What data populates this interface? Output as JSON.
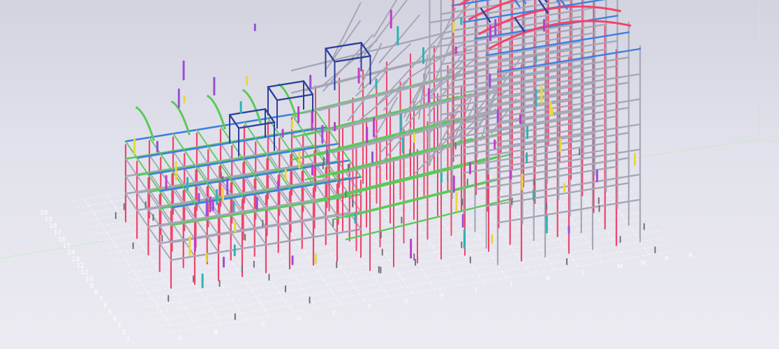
{
  "view": {
    "background_top": "#d3d3e0",
    "background_bottom": "#ecebf2"
  },
  "grid_labels": {
    "letters": [
      "A",
      "B",
      "C",
      "D",
      "E",
      "F",
      "G",
      "H",
      "I",
      "J",
      "K",
      "L",
      "M",
      "N",
      "P",
      "R"
    ],
    "numbers": [
      "1",
      "2",
      "3",
      "4",
      "5",
      "6",
      "7",
      "8",
      "9",
      "10",
      "11",
      "12",
      "13",
      "14",
      "15",
      "16",
      "17",
      "18",
      "19",
      "20"
    ]
  },
  "member_colors": {
    "column": "#f0446a",
    "beam_blue": "#3d7fe0",
    "beam_green": "#5cc85a",
    "beam_grey": "#a6a6b6",
    "truss_navy": "#2c3f9c",
    "bracing_magenta": "#c03cc8",
    "secondary_yellow": "#e8d83a",
    "secondary_teal": "#2fb3b3",
    "secondary_purple": "#9a4fd6"
  }
}
